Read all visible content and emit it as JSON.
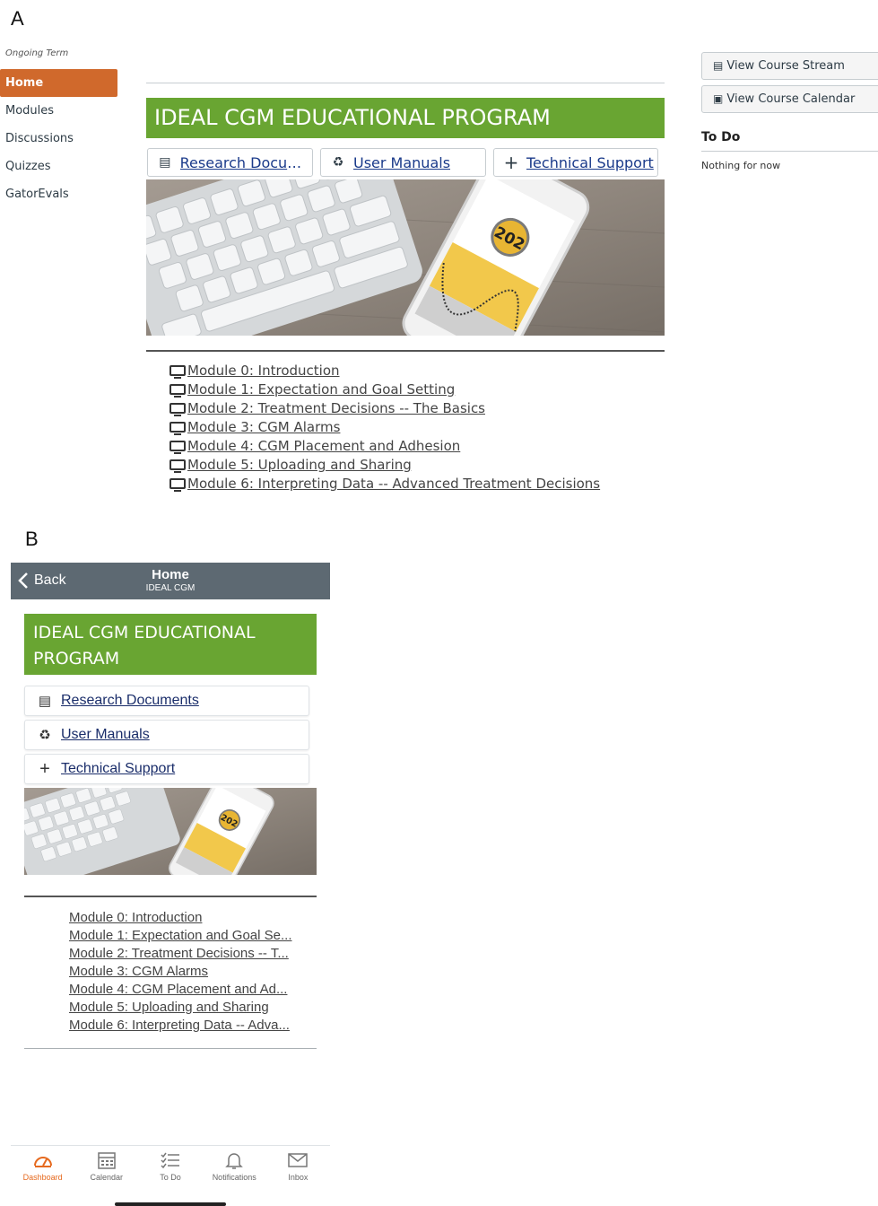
{
  "panel_a": {
    "letter": "A",
    "term": "Ongoing Term",
    "nav": [
      "Home",
      "Modules",
      "Discussions",
      "Quizzes",
      "GatorEvals"
    ],
    "banner_title": "IDEAL CGM EDUCATIONAL PROGRAM",
    "buttons": [
      {
        "label": "Research Docum...",
        "icon": "document-icon"
      },
      {
        "label": "User Manuals",
        "icon": "recycle-icon"
      },
      {
        "label": "Technical Support",
        "icon": "plus-icon"
      }
    ],
    "phone_reading": "202",
    "modules": [
      "Module 0: Introduction",
      "Module 1: Expectation and Goal Setting",
      "Module 2: Treatment Decisions -- The Basics",
      "Module 3: CGM Alarms",
      "Module 4: CGM Placement and Adhesion",
      "Module 5: Uploading and Sharing",
      "Module 6: Interpreting Data -- Advanced Treatment Decisions"
    ],
    "right": {
      "stream_label": "View Course Stream",
      "calendar_label": "View Course Calendar",
      "todo_title": "To Do",
      "todo_empty": "Nothing for now"
    }
  },
  "panel_b": {
    "letter": "B",
    "back_label": "Back",
    "header_title": "Home",
    "header_subtitle": "IDEAL CGM",
    "banner_line1": "IDEAL CGM EDUCATIONAL",
    "banner_line2": "PROGRAM",
    "buttons": [
      {
        "label": "Research Documents",
        "icon": "document-icon"
      },
      {
        "label": "User Manuals",
        "icon": "recycle-icon"
      },
      {
        "label": "Technical Support",
        "icon": "plus-icon"
      }
    ],
    "phone_reading": "202",
    "modules": [
      "Module 0: Introduction",
      "Module 1: Expectation and Goal Se...",
      "Module 2: Treatment Decisions -- T...",
      "Module 3: CGM Alarms",
      "Module 4: CGM Placement and Ad...",
      "Module 5: Uploading and Sharing",
      "Module 6: Interpreting Data -- Adva..."
    ],
    "tabs": [
      {
        "label": "Dashboard",
        "icon": "dashboard-icon",
        "active": true
      },
      {
        "label": "Calendar",
        "icon": "calendar-icon",
        "active": false
      },
      {
        "label": "To Do",
        "icon": "todo-list-icon",
        "active": false
      },
      {
        "label": "Notifications",
        "icon": "bell-icon",
        "active": false
      },
      {
        "label": "Inbox",
        "icon": "envelope-icon",
        "active": false
      }
    ]
  },
  "colors": {
    "accent_orange": "#d0692c",
    "banner_green": "#69a532",
    "mobile_header": "#5d6972",
    "link_blue": "#1a3a8a"
  }
}
